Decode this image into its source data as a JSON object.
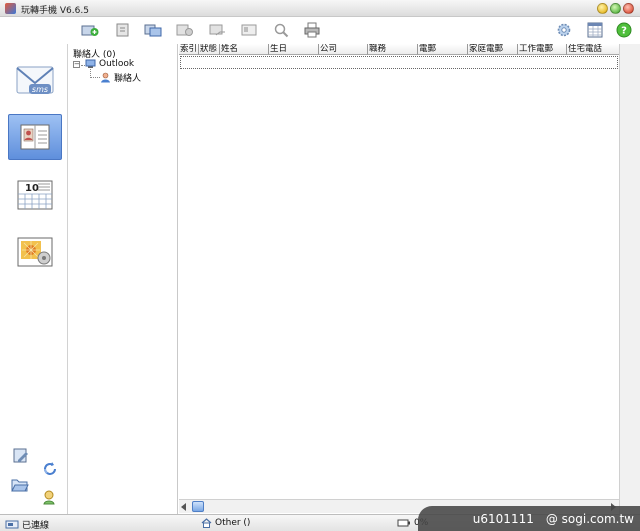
{
  "window": {
    "title": "玩轉手機 V6.6.5"
  },
  "leftnav": {
    "items": [
      {
        "label": "sms",
        "icon": "sms-envelope-icon"
      },
      {
        "label": "",
        "icon": "contacts-card-icon",
        "active": true
      },
      {
        "label": "10",
        "icon": "calendar-icon"
      },
      {
        "label": "",
        "icon": "media-gallery-icon"
      }
    ]
  },
  "tree": {
    "root": "聯絡人 (0)",
    "outlook": "Outlook",
    "contacts": "聯絡人"
  },
  "grid": {
    "columns": [
      "索引",
      "狀態",
      "姓名",
      "生日",
      "公司",
      "職務",
      "電郵",
      "家庭電郵",
      "工作電郵",
      "住宅電話"
    ]
  },
  "status": {
    "connection": "已連線",
    "folder": "Other ()",
    "battery": "0%"
  },
  "watermark": {
    "id": "u6101111",
    "site": "@ sogi.com.tw"
  }
}
